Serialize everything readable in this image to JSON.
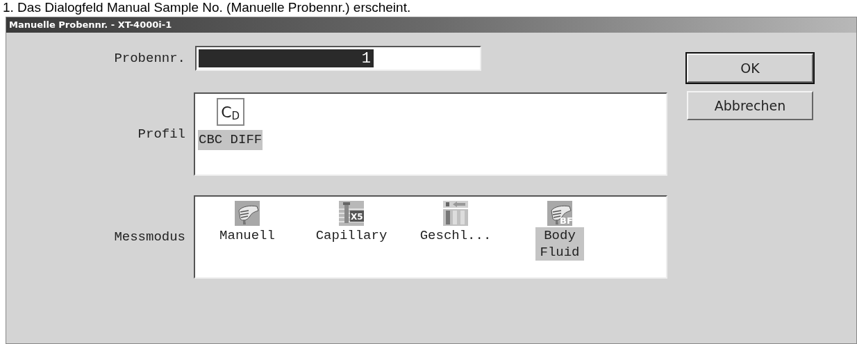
{
  "caption": "1. Das Dialogfeld Manual Sample No. (Manuelle Probennr.) erscheint.",
  "window": {
    "title": "Manuelle Probennr. - XT-4000i-1"
  },
  "sample_no": {
    "label": "Probennr.",
    "value": "1",
    "value_selected": true
  },
  "profile": {
    "label": "Profil",
    "items": [
      {
        "label": "CBC DIFF",
        "selected": true,
        "icon_main": "C",
        "icon_sub": "D"
      }
    ]
  },
  "mode": {
    "label": "Messmodus",
    "items": [
      {
        "kind": "manual",
        "label": "Manuell",
        "selected": false
      },
      {
        "kind": "capillary",
        "label": "Capillary",
        "selected": false,
        "badge": "X5"
      },
      {
        "kind": "closed",
        "label": "Geschl...",
        "selected": false
      },
      {
        "kind": "body_fluid",
        "label": "Body Fluid",
        "selected": true,
        "badge": "BF"
      }
    ]
  },
  "buttons": [
    {
      "label": "OK",
      "default": true
    },
    {
      "label": "Abbrechen",
      "default": false
    }
  ]
}
